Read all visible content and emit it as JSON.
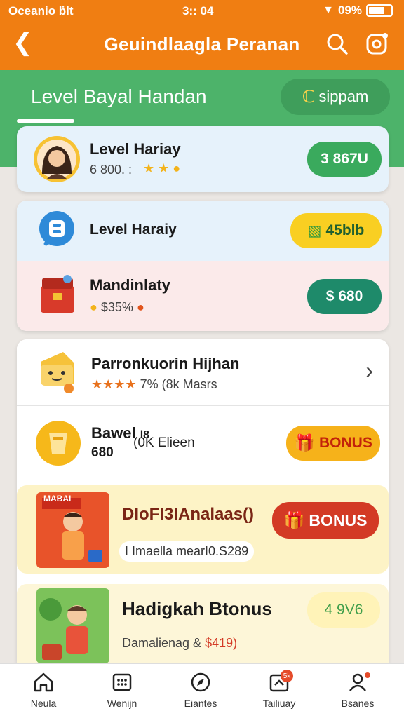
{
  "status_bar": {
    "left_text": "Oceanio ḃlt",
    "time": "3:: 04",
    "battery": "09%"
  },
  "header": {
    "title": "Geuindlaagla Peranan"
  },
  "tabs": {
    "active_label": "Level Bayal Handan",
    "sign_button": "sippam",
    "sign_icon": "coin-icon"
  },
  "colors": {
    "header": "#f07e12",
    "band": "#4db36a",
    "green": "#3aaa5d",
    "yellow": "#f9cf22",
    "teal": "#1e8a6a",
    "red": "#d33a25"
  },
  "cards": {
    "card1": {
      "title": "Level Hariay",
      "subtitle": "6 800. :",
      "rating_stars": 3,
      "button": "3 867U"
    },
    "card2": {
      "row1": {
        "title": "Level Haraiy",
        "button": "45blb"
      },
      "row2": {
        "title": "Mandinlaty",
        "subtitle": "$35%",
        "button": "$ 680"
      }
    },
    "card3": {
      "row1": {
        "title": "Parronkuorin Hijhan",
        "rating_stars": 4,
        "subtitle": "7% (8k Masrs"
      },
      "row2": {
        "title_line1": "Bawel",
        "title_mark": "l8",
        "title_line2": "680",
        "subtitle": "(0K Elieen",
        "button": "BONUS"
      },
      "row3": {
        "title": "DIoFI3IAnalaas()",
        "subtitle": "I Imaella mearI0.S289",
        "button": "BONUS",
        "promo_text": "MABAI"
      },
      "row4": {
        "title": "Hadigkah Btonus",
        "subtitle_prefix": "Damalienag & ",
        "subtitle_amount": "$419)",
        "button": "4 9V6"
      }
    }
  },
  "bottom_nav": [
    {
      "label": "Neula",
      "icon": "home-icon"
    },
    {
      "label": "Wenijn",
      "icon": "grid-icon"
    },
    {
      "label": "Eiantes",
      "icon": "compass-icon"
    },
    {
      "label": "Tailiuay",
      "icon": "ticket-icon",
      "badge": "5k"
    },
    {
      "label": "Bsanes",
      "icon": "profile-icon"
    }
  ]
}
